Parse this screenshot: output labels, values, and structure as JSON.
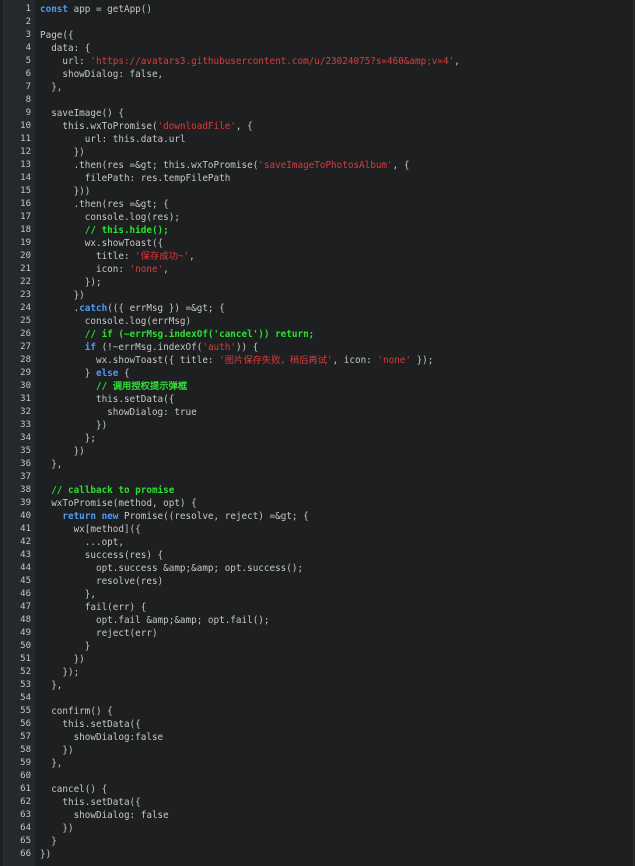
{
  "editor": {
    "lines": [
      [
        {
          "t": "kw",
          "v": "const"
        },
        {
          "t": "p",
          "v": " app = getApp()"
        }
      ],
      [],
      [
        {
          "t": "p",
          "v": "Page({"
        }
      ],
      [
        {
          "t": "p",
          "v": "  data: {"
        }
      ],
      [
        {
          "t": "p",
          "v": "    url: "
        },
        {
          "t": "str",
          "v": "'https://avatars3.githubusercontent.com/u/23024075?s=460&amp;v=4'"
        },
        {
          "t": "p",
          "v": ","
        }
      ],
      [
        {
          "t": "p",
          "v": "    showDialog: false,"
        }
      ],
      [
        {
          "t": "p",
          "v": "  },"
        }
      ],
      [],
      [
        {
          "t": "p",
          "v": "  saveImage() {"
        }
      ],
      [
        {
          "t": "p",
          "v": "    this.wxToPromise("
        },
        {
          "t": "str",
          "v": "'downloadFile'"
        },
        {
          "t": "p",
          "v": ", {"
        }
      ],
      [
        {
          "t": "p",
          "v": "        url: this.data.url"
        }
      ],
      [
        {
          "t": "p",
          "v": "      })"
        }
      ],
      [
        {
          "t": "p",
          "v": "      .then(res =&gt; this.wxToPromise("
        },
        {
          "t": "str",
          "v": "'saveImageToPhotosAlbum'"
        },
        {
          "t": "p",
          "v": ", {"
        }
      ],
      [
        {
          "t": "p",
          "v": "        filePath: res.tempFilePath"
        }
      ],
      [
        {
          "t": "p",
          "v": "      }))"
        }
      ],
      [
        {
          "t": "p",
          "v": "      .then(res =&gt; {"
        }
      ],
      [
        {
          "t": "p",
          "v": "        console.log(res);"
        }
      ],
      [
        {
          "t": "cm",
          "v": "        // this.hide();"
        }
      ],
      [
        {
          "t": "p",
          "v": "        wx.showToast({"
        }
      ],
      [
        {
          "t": "p",
          "v": "          title: "
        },
        {
          "t": "str",
          "v": "'保存成功~'"
        },
        {
          "t": "p",
          "v": ","
        }
      ],
      [
        {
          "t": "p",
          "v": "          icon: "
        },
        {
          "t": "str",
          "v": "'none'"
        },
        {
          "t": "p",
          "v": ","
        }
      ],
      [
        {
          "t": "p",
          "v": "        });"
        }
      ],
      [
        {
          "t": "p",
          "v": "      })"
        }
      ],
      [
        {
          "t": "p",
          "v": "      ."
        },
        {
          "t": "kw",
          "v": "catch"
        },
        {
          "t": "p",
          "v": "(({ errMsg }) =&gt; {"
        }
      ],
      [
        {
          "t": "p",
          "v": "        console.log(errMsg)"
        }
      ],
      [
        {
          "t": "cm",
          "v": "        // if (~errMsg.indexOf('cancel')) return;"
        }
      ],
      [
        {
          "t": "p",
          "v": "        "
        },
        {
          "t": "kw",
          "v": "if"
        },
        {
          "t": "p",
          "v": " (!~errMsg.indexOf("
        },
        {
          "t": "str",
          "v": "'auth'"
        },
        {
          "t": "p",
          "v": ")) {"
        }
      ],
      [
        {
          "t": "p",
          "v": "          wx.showToast({ title: "
        },
        {
          "t": "str",
          "v": "'图片保存失败，稍后再试'"
        },
        {
          "t": "p",
          "v": ", icon: "
        },
        {
          "t": "str",
          "v": "'none'"
        },
        {
          "t": "p",
          "v": " });"
        }
      ],
      [
        {
          "t": "p",
          "v": "        } "
        },
        {
          "t": "kw",
          "v": "else"
        },
        {
          "t": "p",
          "v": " {"
        }
      ],
      [
        {
          "t": "cm",
          "v": "          // 调用授权提示弹框"
        }
      ],
      [
        {
          "t": "p",
          "v": "          this.setData({"
        }
      ],
      [
        {
          "t": "p",
          "v": "            showDialog: true"
        }
      ],
      [
        {
          "t": "p",
          "v": "          })"
        }
      ],
      [
        {
          "t": "p",
          "v": "        };"
        }
      ],
      [
        {
          "t": "p",
          "v": "      })"
        }
      ],
      [
        {
          "t": "p",
          "v": "  },"
        }
      ],
      [],
      [
        {
          "t": "cm",
          "v": "  // callback to promise"
        }
      ],
      [
        {
          "t": "p",
          "v": "  wxToPromise(method, opt) {"
        }
      ],
      [
        {
          "t": "p",
          "v": "    "
        },
        {
          "t": "kw",
          "v": "return new"
        },
        {
          "t": "p",
          "v": " Promise((resolve, reject) =&gt; {"
        }
      ],
      [
        {
          "t": "p",
          "v": "      wx[method]({"
        }
      ],
      [
        {
          "t": "p",
          "v": "        ...opt,"
        }
      ],
      [
        {
          "t": "p",
          "v": "        success(res) {"
        }
      ],
      [
        {
          "t": "p",
          "v": "          opt.success &amp;&amp; opt.success();"
        }
      ],
      [
        {
          "t": "p",
          "v": "          resolve(res)"
        }
      ],
      [
        {
          "t": "p",
          "v": "        },"
        }
      ],
      [
        {
          "t": "p",
          "v": "        fail(err) {"
        }
      ],
      [
        {
          "t": "p",
          "v": "          opt.fail &amp;&amp; opt.fail();"
        }
      ],
      [
        {
          "t": "p",
          "v": "          reject(err)"
        }
      ],
      [
        {
          "t": "p",
          "v": "        }"
        }
      ],
      [
        {
          "t": "p",
          "v": "      })"
        }
      ],
      [
        {
          "t": "p",
          "v": "    });"
        }
      ],
      [
        {
          "t": "p",
          "v": "  },"
        }
      ],
      [],
      [
        {
          "t": "p",
          "v": "  confirm() {"
        }
      ],
      [
        {
          "t": "p",
          "v": "    this.setData({"
        }
      ],
      [
        {
          "t": "p",
          "v": "      showDialog:false"
        }
      ],
      [
        {
          "t": "p",
          "v": "    })"
        }
      ],
      [
        {
          "t": "p",
          "v": "  },"
        }
      ],
      [],
      [
        {
          "t": "p",
          "v": "  cancel() {"
        }
      ],
      [
        {
          "t": "p",
          "v": "    this.setData({"
        }
      ],
      [
        {
          "t": "p",
          "v": "      showDialog: false"
        }
      ],
      [
        {
          "t": "p",
          "v": "    })"
        }
      ],
      [
        {
          "t": "p",
          "v": "  }"
        }
      ],
      [
        {
          "t": "p",
          "v": "})"
        }
      ]
    ]
  }
}
